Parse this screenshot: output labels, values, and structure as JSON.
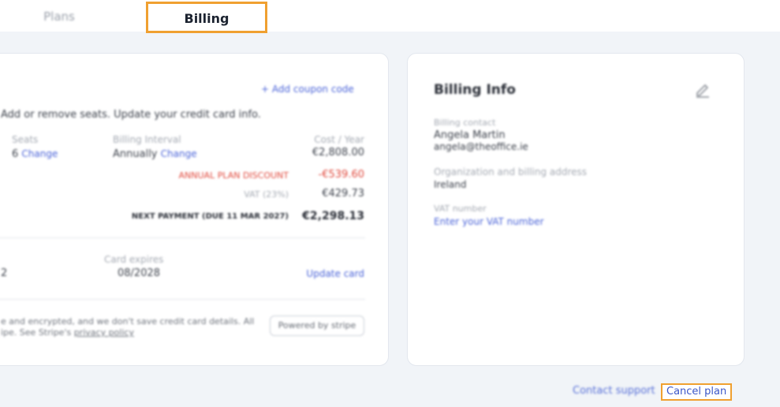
{
  "tabs": {
    "plans_label": "Plans",
    "billing_label": "Billing"
  },
  "subscription": {
    "add_coupon": "+ Add coupon code",
    "description": "Add or remove seats. Update your credit card info.",
    "seats_label": "Seats",
    "seats_value": "6",
    "seats_change": "Change",
    "interval_label": "Billing Interval",
    "interval_value": "Annually",
    "interval_change": "Change",
    "cost_label": "Cost / Year",
    "cost_value": "€2,808.00",
    "discount_label": "ANNUAL PLAN DISCOUNT",
    "discount_value": "-€539.60",
    "vat_label": "VAT (23%)",
    "vat_value": "€429.73",
    "next_payment_label": "NEXT PAYMENT (DUE 11 MAR 2027)",
    "next_payment_value": "€2,298.13",
    "card_number_tail": "2",
    "card_expires_label": "Card expires",
    "card_expires_value": "08/2028",
    "update_card": "Update card",
    "secure_line1": "e and encrypted, and we don't save credit card details. All",
    "secure_line2": "ipe. See Stripe's",
    "privacy_link": "privacy policy",
    "powered_by": "Powered by stripe"
  },
  "billing_info": {
    "title": "Billing Info",
    "contact_label": "Billing contact",
    "contact_name": "Angela Martin",
    "contact_email": "angela@theoffice.ie",
    "address_label": "Organization and billing address",
    "address_value": "Ireland",
    "vat_label": "VAT number",
    "vat_link": "Enter your VAT number"
  },
  "footer": {
    "contact_support": "Contact support",
    "cancel_plan": "Cancel plan"
  }
}
